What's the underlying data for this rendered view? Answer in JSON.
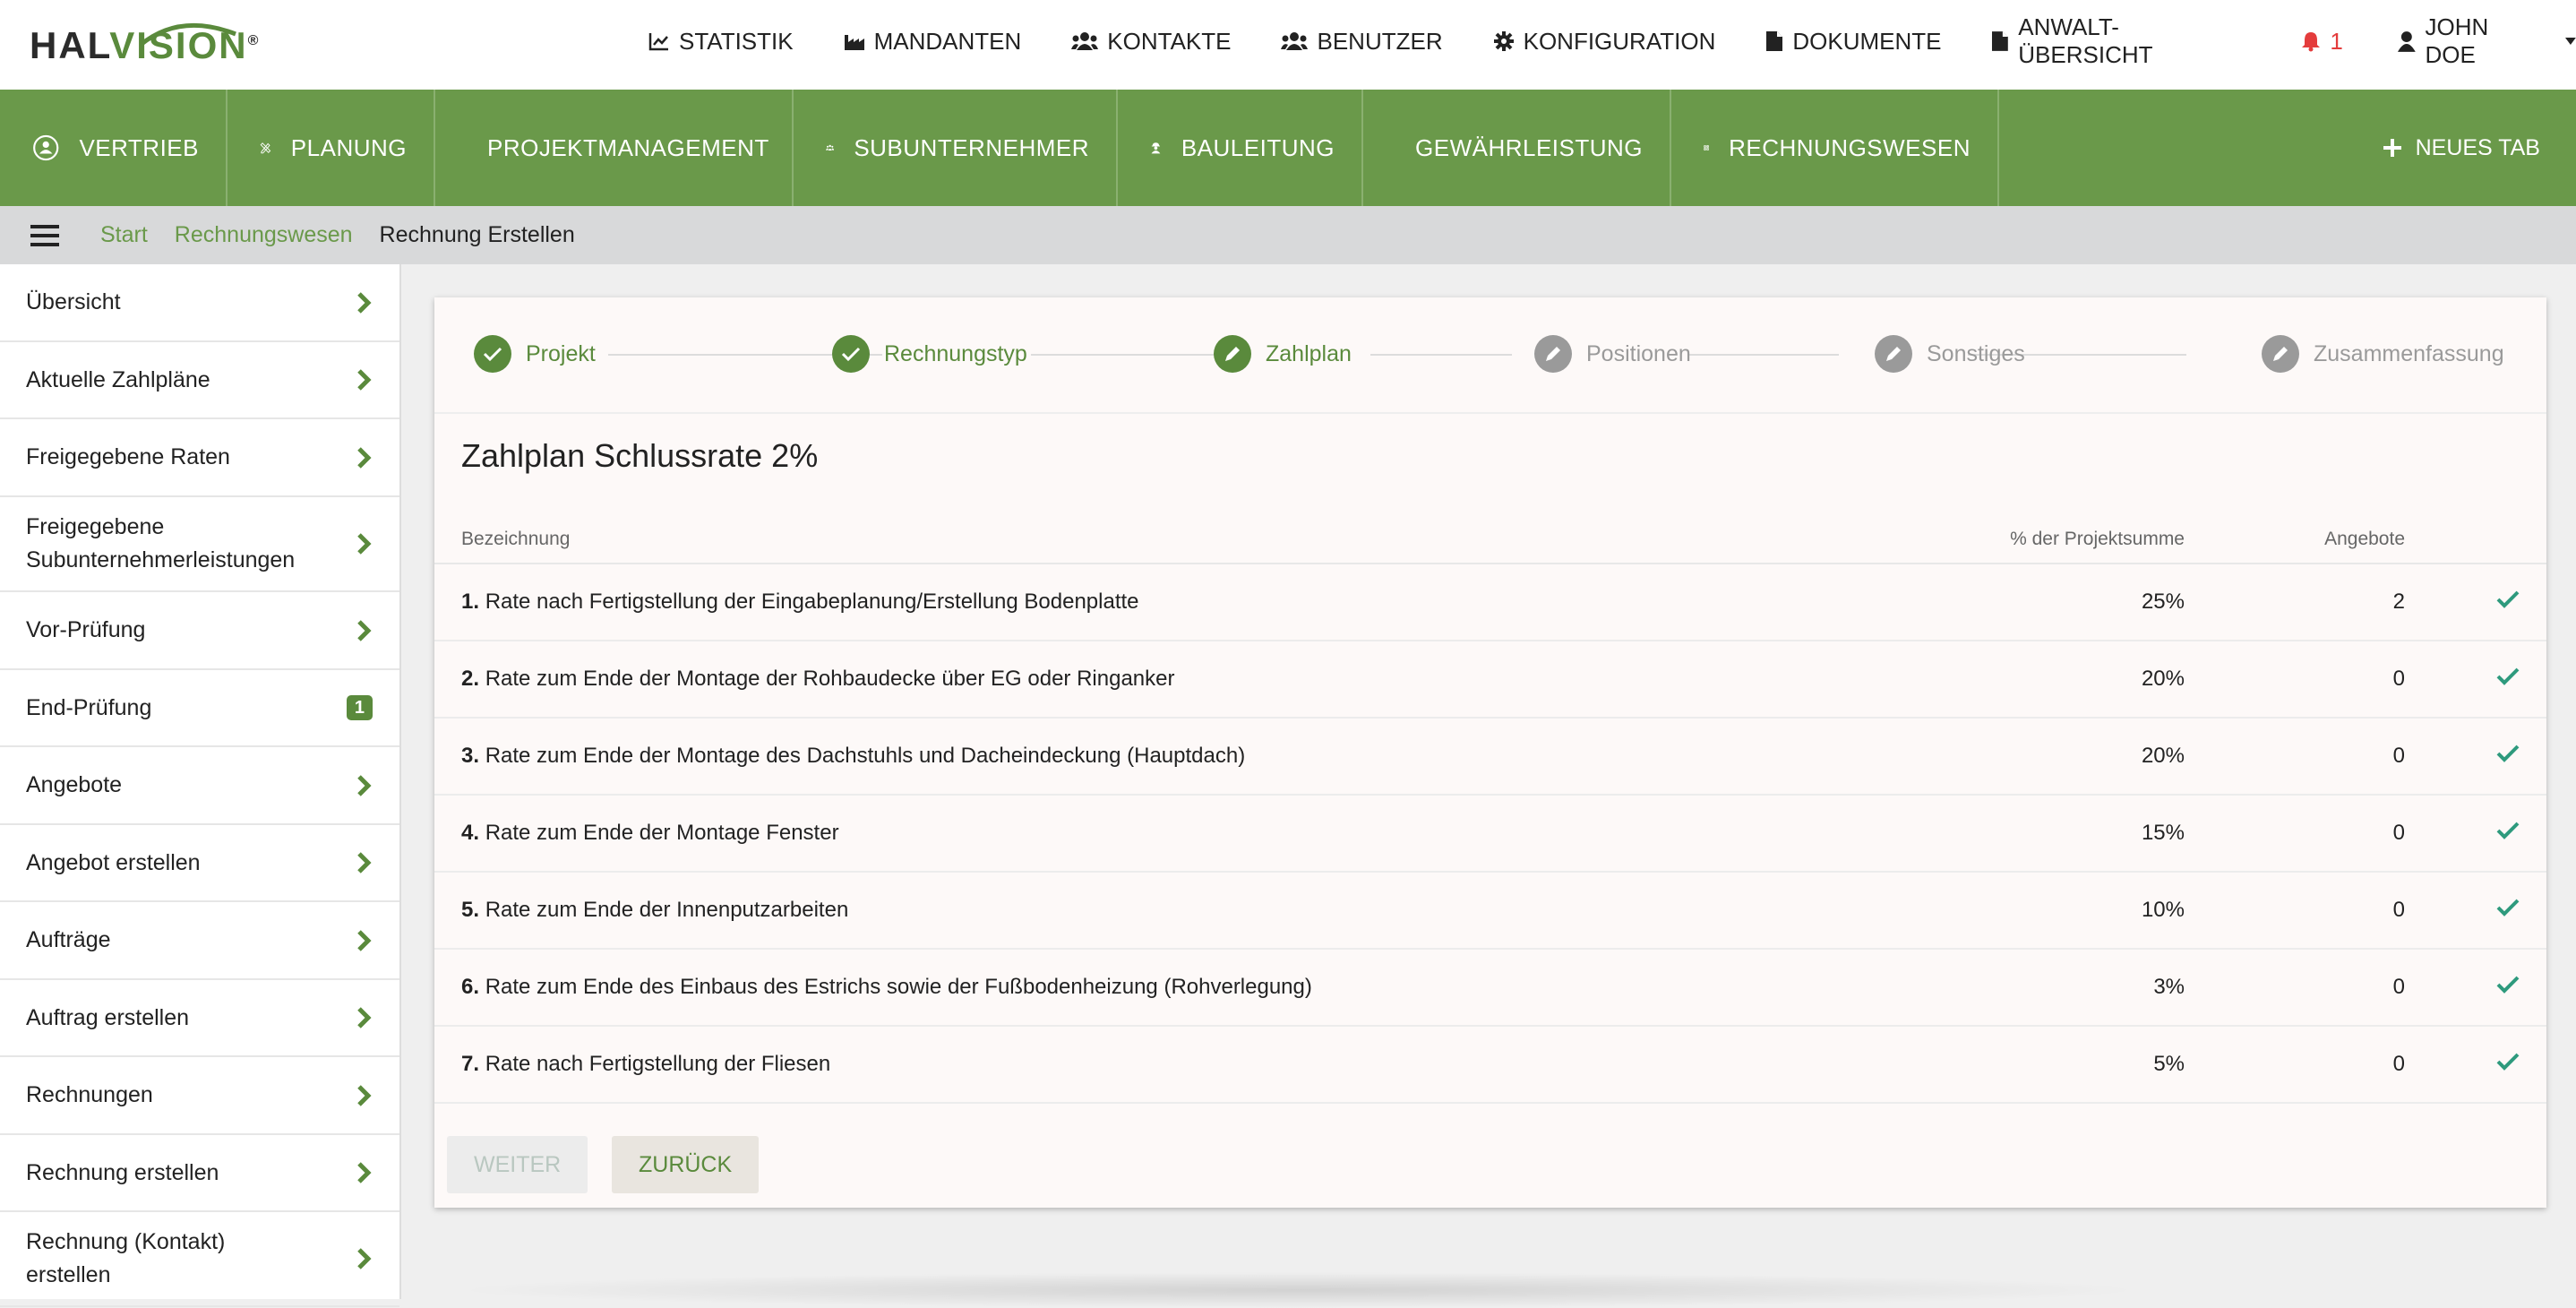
{
  "brand": {
    "logo_hal": "HAL",
    "logo_vision": "VISION",
    "logo_mark": "®"
  },
  "topnav": {
    "items": [
      {
        "label": "STATISTIK",
        "icon": "chart-icon"
      },
      {
        "label": "MANDANTEN",
        "icon": "factory-icon"
      },
      {
        "label": "KONTAKTE",
        "icon": "users-icon"
      },
      {
        "label": "BENUTZER",
        "icon": "users-icon"
      },
      {
        "label": "KONFIGURATION",
        "icon": "gear-icon"
      },
      {
        "label": "DOKUMENTE",
        "icon": "file-icon"
      },
      {
        "label": "ANWALT-ÜBERSICHT",
        "icon": "file-icon"
      }
    ],
    "notifications": "1",
    "user": "JOHN DOE"
  },
  "modules": {
    "items": [
      {
        "label": "VERTRIEB",
        "icon": "sales-icon"
      },
      {
        "label": "PLANUNG",
        "icon": "pencil-ruler-icon"
      },
      {
        "label": "PROJEKTMANAGEMENT",
        "icon": "cog-network-icon"
      },
      {
        "label": "SUBUNTERNEHMER",
        "icon": "team-icon"
      },
      {
        "label": "BAULEITUNG",
        "icon": "worker-icon"
      },
      {
        "label": "GEWÄHRLEISTUNG",
        "icon": "clipboard-check-icon"
      },
      {
        "label": "RECHNUNGSWESEN",
        "icon": "calculator-icon"
      }
    ],
    "new_tab": "NEUES TAB"
  },
  "breadcrumb": {
    "start": "Start",
    "section": "Rechnungswesen",
    "current": "Rechnung Erstellen"
  },
  "sidebar": {
    "items": [
      {
        "label": "Übersicht"
      },
      {
        "label": "Aktuelle Zahlpläne"
      },
      {
        "label": "Freigegebene Raten"
      },
      {
        "label": "Freigegebene Subunternehmerleistungen"
      },
      {
        "label": "Vor-Prüfung"
      },
      {
        "label": "End-Prüfung",
        "badge": "1"
      },
      {
        "label": "Angebote"
      },
      {
        "label": "Angebot erstellen"
      },
      {
        "label": "Aufträge"
      },
      {
        "label": "Auftrag erstellen"
      },
      {
        "label": "Rechnungen"
      },
      {
        "label": "Rechnung erstellen"
      },
      {
        "label": "Rechnung (Kontakt) erstellen"
      }
    ]
  },
  "stepper": {
    "steps": [
      {
        "label": "Projekt",
        "state": "done"
      },
      {
        "label": "Rechnungstyp",
        "state": "done"
      },
      {
        "label": "Zahlplan",
        "state": "active"
      },
      {
        "label": "Positionen",
        "state": "todo"
      },
      {
        "label": "Sonstiges",
        "state": "todo"
      },
      {
        "label": "Zusammenfassung",
        "state": "todo"
      }
    ]
  },
  "plan": {
    "title": "Zahlplan Schlussrate 2%",
    "headers": {
      "name": "Bezeichnung",
      "percent": "% der Projektsumme",
      "offers": "Angebote"
    },
    "rows": [
      {
        "num": "1.",
        "text": "Rate nach Fertigstellung der Eingabeplanung/Erstellung Bodenplatte",
        "percent": "25%",
        "offers": "2"
      },
      {
        "num": "2.",
        "text": "Rate zum Ende der Montage der Rohbaudecke über EG oder Ringanker",
        "percent": "20%",
        "offers": "0"
      },
      {
        "num": "3.",
        "text": "Rate zum Ende der Montage des Dachstuhls und Dacheindeckung (Hauptdach)",
        "percent": "20%",
        "offers": "0"
      },
      {
        "num": "4.",
        "text": "Rate zum Ende der Montage Fenster",
        "percent": "15%",
        "offers": "0"
      },
      {
        "num": "5.",
        "text": "Rate zum Ende der Innenputzarbeiten",
        "percent": "10%",
        "offers": "0"
      },
      {
        "num": "6.",
        "text": "Rate zum Ende des Einbaus des Estrichs sowie der Fußbodenheizung (Rohverlegung)",
        "percent": "3%",
        "offers": "0"
      },
      {
        "num": "7.",
        "text": "Rate nach Fertigstellung der Fliesen",
        "percent": "5%",
        "offers": "0"
      }
    ]
  },
  "buttons": {
    "next": "WEITER",
    "back": "ZURÜCK"
  },
  "colors": {
    "brand_green": "#6a994a",
    "text_green": "#5a8a3c",
    "step_todo": "#9a9a9a",
    "check_teal": "#2e9a7d",
    "alert_red": "#e43c3c"
  }
}
